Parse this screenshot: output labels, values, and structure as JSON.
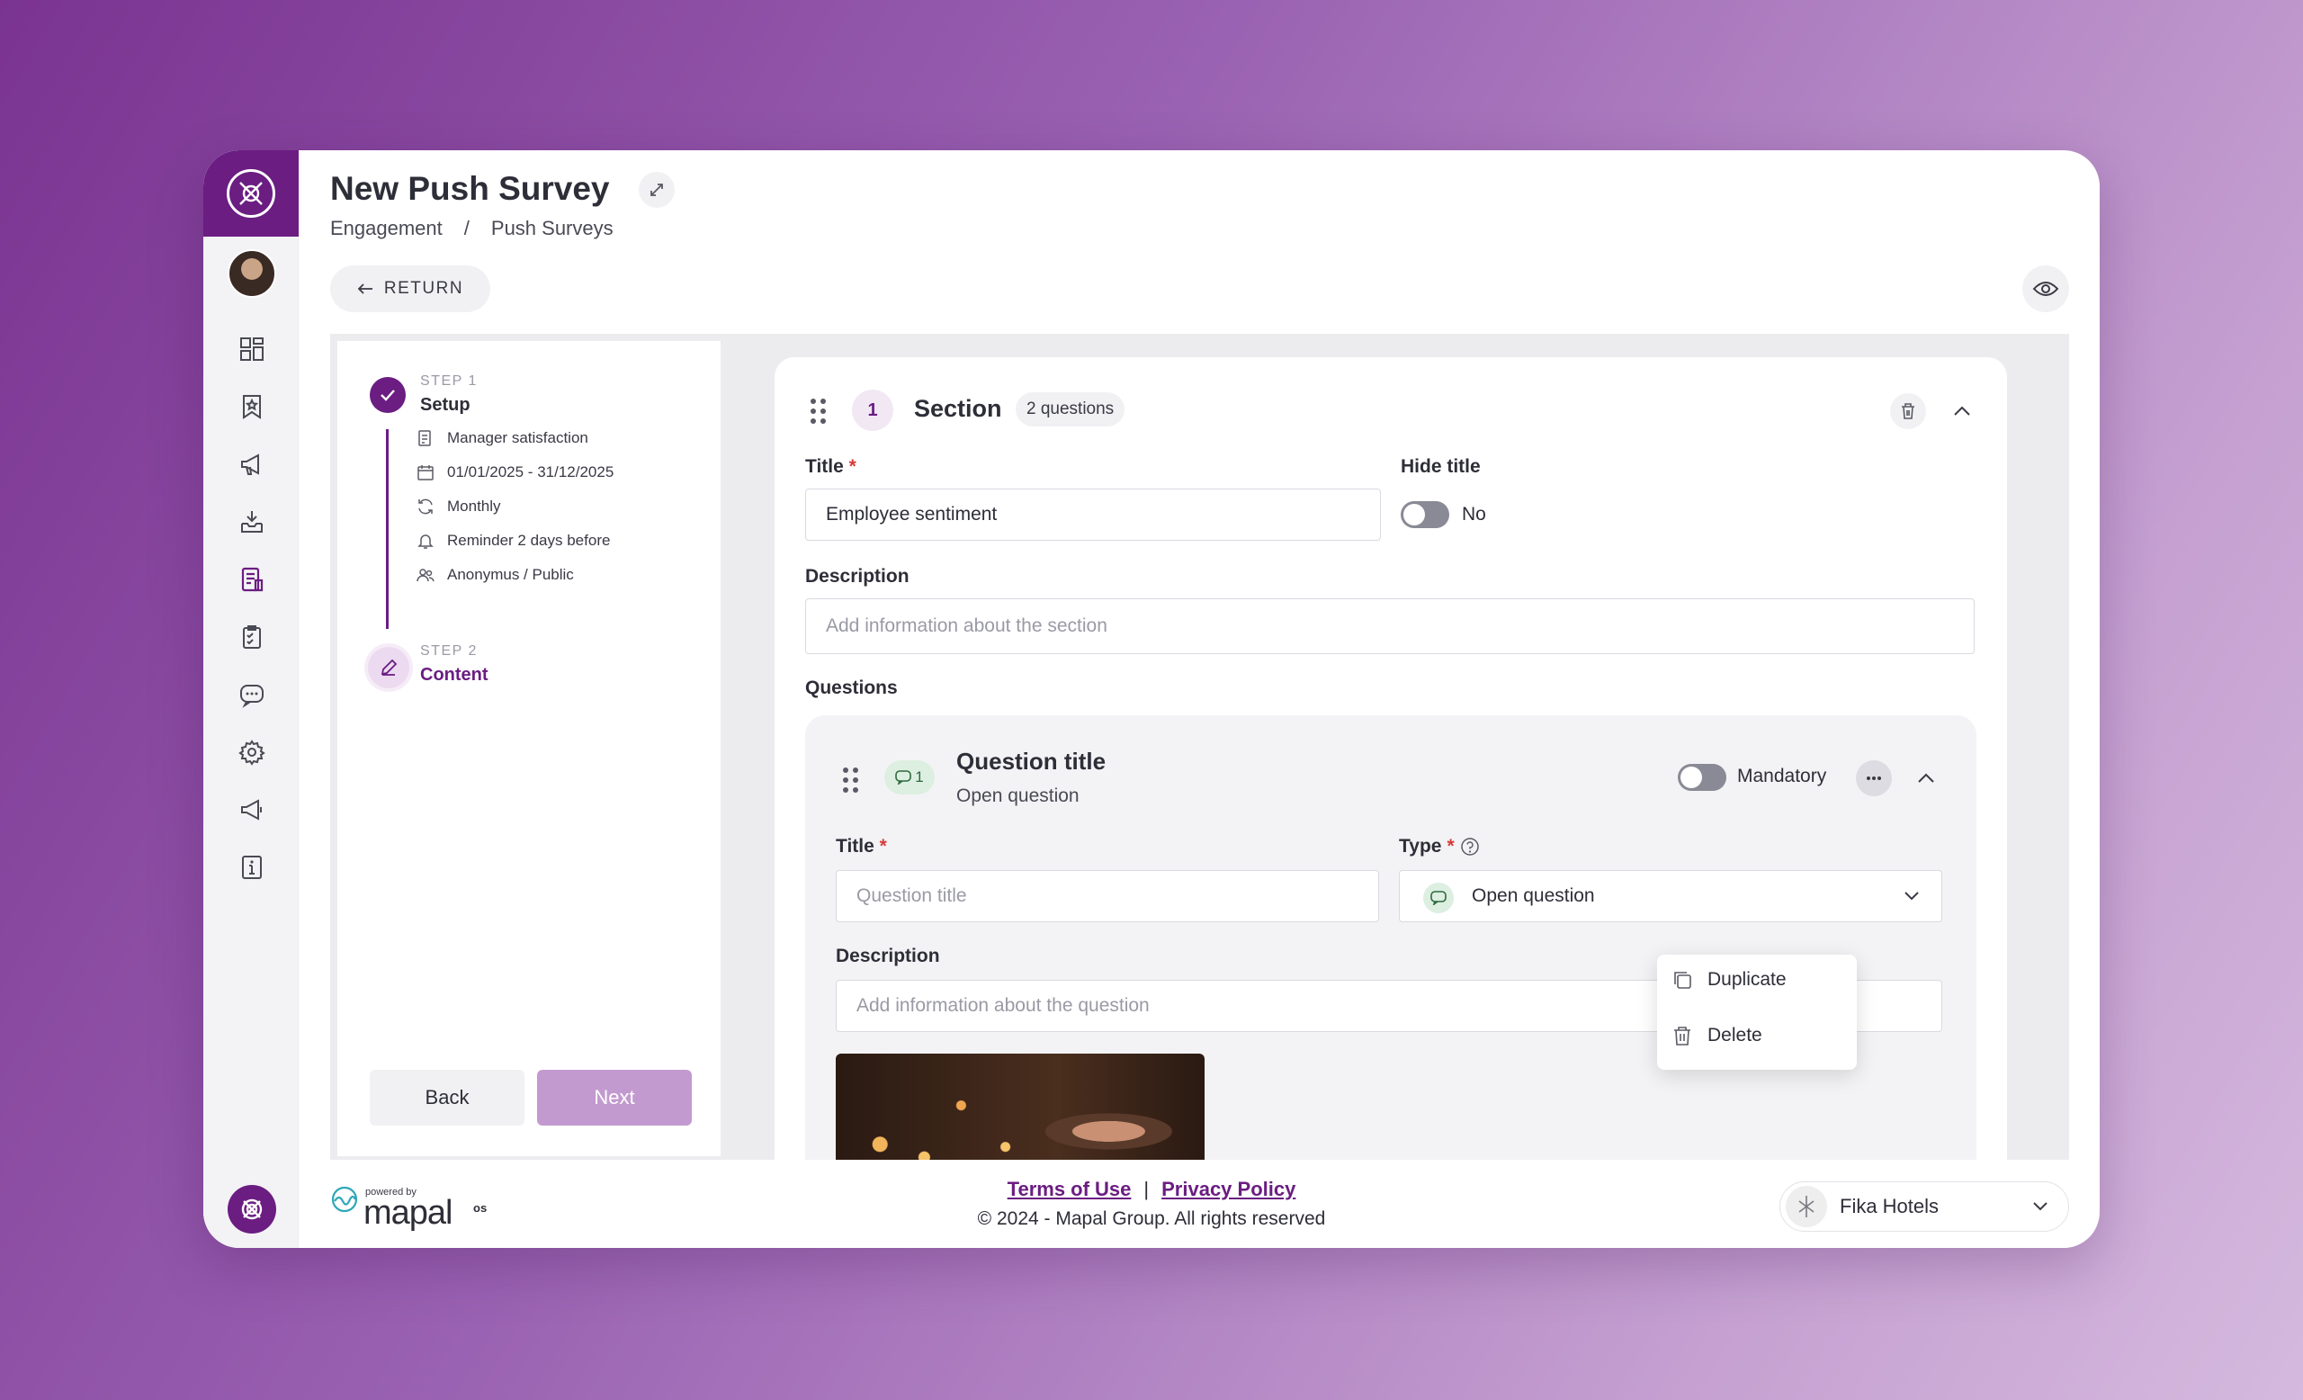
{
  "header": {
    "title": "New Push Survey",
    "breadcrumb": [
      "Engagement",
      "/",
      "Push Surveys"
    ],
    "return_label": "RETURN"
  },
  "steps": {
    "step1": {
      "label_small": "STEP 1",
      "label": "Setup",
      "details": [
        {
          "icon": "document-icon",
          "text": "Manager satisfaction"
        },
        {
          "icon": "calendar-icon",
          "text": "01/01/2025 - 31/12/2025"
        },
        {
          "icon": "refresh-icon",
          "text": "Monthly"
        },
        {
          "icon": "bell-icon",
          "text": "Reminder 2 days before"
        },
        {
          "icon": "users-icon",
          "text": "Anonymus / Public"
        }
      ]
    },
    "step2": {
      "label_small": "STEP 2",
      "label": "Content"
    },
    "back_label": "Back",
    "next_label": "Next"
  },
  "section": {
    "number": "1",
    "title": "Section",
    "question_count": "2 questions",
    "title_label": "Title",
    "required_mark": "*",
    "title_value": "Employee sentiment",
    "hide_title_label": "Hide title",
    "hide_title_value": "No",
    "description_label": "Description",
    "description_placeholder": "Add information about the section",
    "questions_label": "Questions"
  },
  "question": {
    "badge": "1",
    "title": "Question title",
    "subtitle": "Open question",
    "mandatory_label": "Mandatory",
    "title_label": "Title",
    "title_placeholder": "Question title",
    "type_label": "Type",
    "type_value": "Open question",
    "description_label": "Description",
    "description_placeholder": "Add information about the question"
  },
  "menu": {
    "items": [
      {
        "icon": "duplicate-icon",
        "label": "Duplicate"
      },
      {
        "icon": "trash-icon",
        "label": "Delete"
      }
    ]
  },
  "footer": {
    "powered_by": "powered by",
    "brand": "mapal",
    "brand_suffix": "os",
    "terms": "Terms of Use",
    "separator": "|",
    "privacy": "Privacy Policy",
    "copyright": "© 2024 - Mapal Group. All rights reserved",
    "company": "Fika Hotels"
  },
  "colors": {
    "brand": "#6b1d82",
    "next_disabled": "#c39ad0",
    "required": "#d63a3a"
  }
}
